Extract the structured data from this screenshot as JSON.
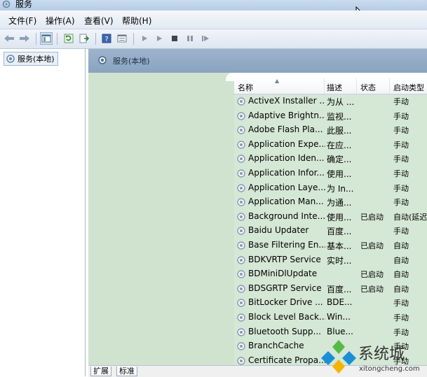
{
  "window": {
    "title": "服务"
  },
  "menu": [
    "文件(F)",
    "操作(A)",
    "查看(V)",
    "帮助(H)"
  ],
  "toolbar": {
    "buttons": [
      "back-icon",
      "forward-icon",
      "show-console-tree-icon",
      "refresh-icon",
      "export-icon",
      "help-icon",
      "properties-icon",
      "start-service-icon",
      "start-alt-icon",
      "stop-icon",
      "pause-icon",
      "restart-icon"
    ]
  },
  "tree": {
    "root": "服务(本地)"
  },
  "panel": {
    "header": "服务(本地)"
  },
  "columns": [
    "名称",
    "描述",
    "状态",
    "启动类型"
  ],
  "rows": [
    [
      "ActiveX Installer ...",
      "为从 ...",
      "",
      "手动"
    ],
    [
      "Adaptive Brightn...",
      "监视...",
      "",
      "手动"
    ],
    [
      "Adobe Flash Pla...",
      "此服...",
      "",
      "手动"
    ],
    [
      "Application Expe...",
      "在应...",
      "",
      "手动"
    ],
    [
      "Application Iden...",
      "确定...",
      "",
      "手动"
    ],
    [
      "Application Infor...",
      "使用...",
      "",
      "手动"
    ],
    [
      "Application Laye...",
      "为 In...",
      "",
      "手动"
    ],
    [
      "Application Man...",
      "为通...",
      "",
      "手动"
    ],
    [
      "Background Inte...",
      "使用...",
      "已启动",
      "自动(延迟"
    ],
    [
      "Baidu Updater",
      "百度...",
      "",
      "手动"
    ],
    [
      "Base Filtering En...",
      "基本...",
      "已启动",
      "自动"
    ],
    [
      "BDKVRTP Service",
      "实时...",
      "",
      "自动"
    ],
    [
      "BDMiniDlUpdate",
      "",
      "已启动",
      "自动"
    ],
    [
      "BDSGRTP Service",
      "百度...",
      "已启动",
      "自动"
    ],
    [
      "BitLocker Drive ...",
      "BDE...",
      "",
      "手动"
    ],
    [
      "Block Level Back...",
      "Win...",
      "",
      "手动"
    ],
    [
      "Bluetooth Supp...",
      "Blue...",
      "",
      "手动"
    ],
    [
      "BranchCache",
      "",
      "",
      "手动"
    ],
    [
      "Certificate Propa...",
      "",
      "",
      "手动"
    ]
  ],
  "bottom_tabs": [
    "扩展",
    "标准"
  ],
  "watermark": {
    "text": "系统城",
    "url": "xitongcheng.com"
  }
}
